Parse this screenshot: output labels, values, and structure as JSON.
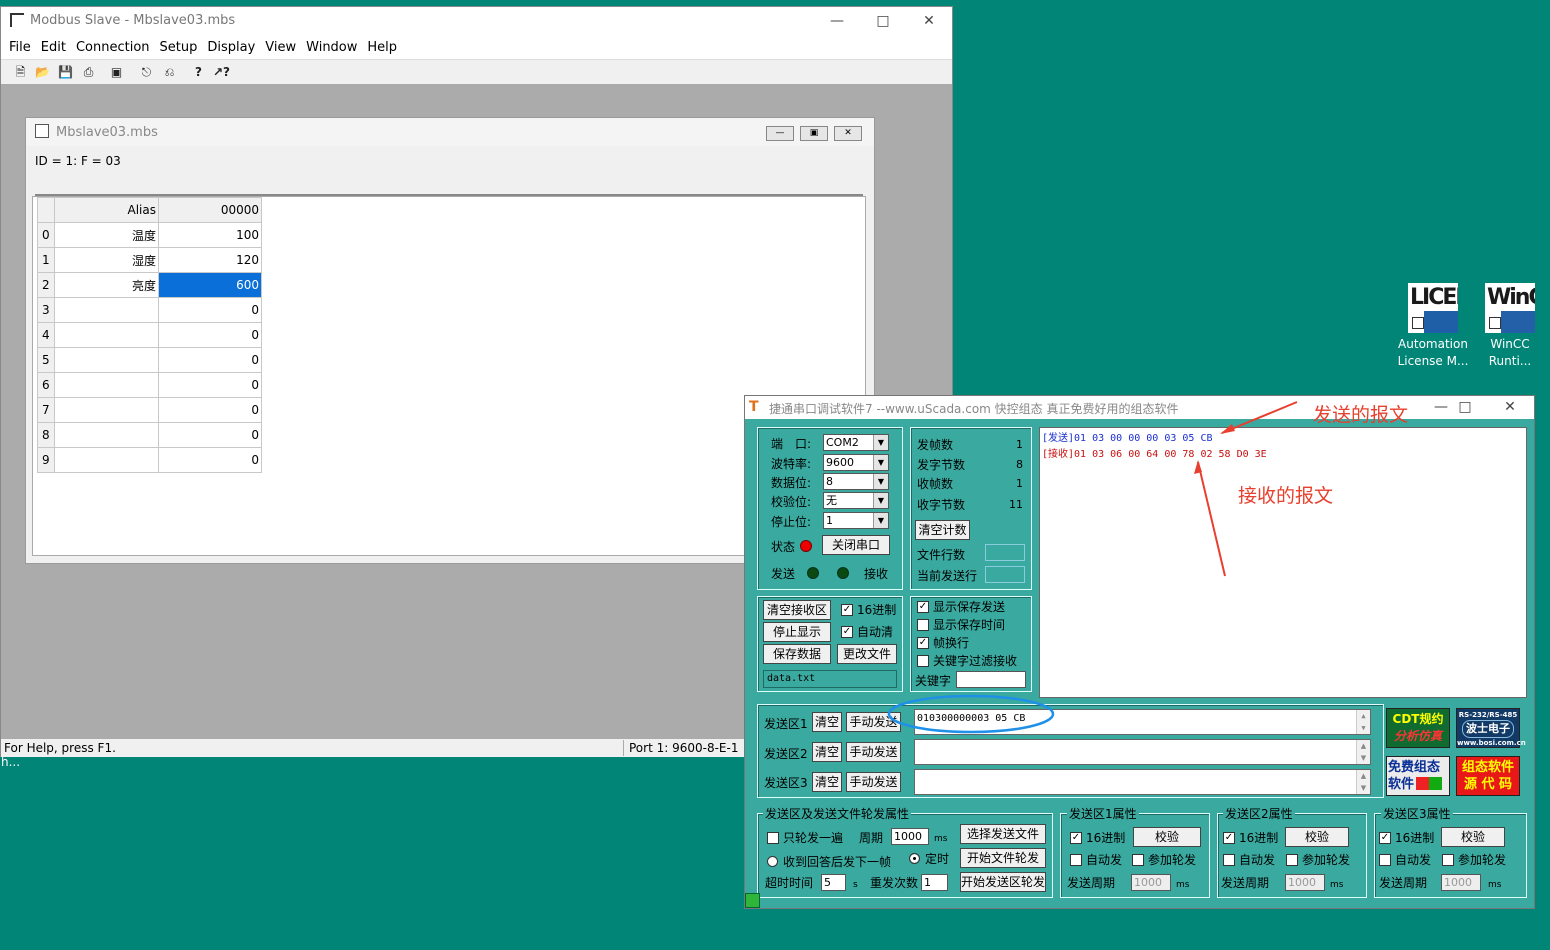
{
  "desktop": {
    "icons": [
      {
        "thumb": "LICEN",
        "line1": "Automation",
        "line2": "License M..."
      },
      {
        "thumb": "WinC",
        "line1": "WinCC",
        "line2": "Runti..."
      }
    ],
    "stray_text": "h..."
  },
  "modbus": {
    "title": "Modbus Slave - Mbslave03.mbs",
    "menu": [
      "File",
      "Edit",
      "Connection",
      "Setup",
      "Display",
      "View",
      "Window",
      "Help"
    ],
    "status_left": "For Help, press F1.",
    "status_right": "Port 1: 9600-8-E-1",
    "child": {
      "title": "Mbslave03.mbs",
      "header": "ID = 1: F = 03",
      "col_alias": "Alias",
      "col_addr": "00000",
      "rows": [
        {
          "n": "0",
          "alias": "温度",
          "value": "100"
        },
        {
          "n": "1",
          "alias": "湿度",
          "value": "120"
        },
        {
          "n": "2",
          "alias": "亮度",
          "value": "600"
        },
        {
          "n": "3",
          "alias": "",
          "value": "0"
        },
        {
          "n": "4",
          "alias": "",
          "value": "0"
        },
        {
          "n": "5",
          "alias": "",
          "value": "0"
        },
        {
          "n": "6",
          "alias": "",
          "value": "0"
        },
        {
          "n": "7",
          "alias": "",
          "value": "0"
        },
        {
          "n": "8",
          "alias": "",
          "value": "0"
        },
        {
          "n": "9",
          "alias": "",
          "value": "0"
        }
      ]
    }
  },
  "serial": {
    "title": "捷通串口调试软件7  --www.uScada.com  快控组态  真正免费好用的组态软件",
    "port_label": "端　口:",
    "port_value": "COM2",
    "baud_label": "波特率:",
    "baud_value": "9600",
    "data_label": "数据位:",
    "data_value": "8",
    "parity_label": "校验位:",
    "parity_value": "无",
    "stop_label": "停止位:",
    "stop_value": "1",
    "state_label": "状态",
    "close_port": "关闭串口",
    "send_label": "发送",
    "recv_label": "接收",
    "stats": [
      {
        "label": "发帧数",
        "value": "1"
      },
      {
        "label": "发字节数",
        "value": "8"
      },
      {
        "label": "收帧数",
        "value": "1"
      },
      {
        "label": "收字节数",
        "value": "11"
      }
    ],
    "clear_count": "清空计数",
    "file_lines": "文件行数",
    "current_line": "当前发送行",
    "log_send": "[发送]01 03 00 00 00 03 05 CB",
    "log_recv": "[接收]01 03 06 00 64 00 78 02 58 D0 3E",
    "clear_recv": "清空接收区",
    "stop_display": "停止显示",
    "save_data": "保存数据",
    "change_file": "更改文件",
    "hex16": "16进制",
    "auto_clear": "自动清",
    "filename": "data.txt",
    "opt_show_save_send": "显示保存发送",
    "opt_show_save_time": "显示保存时间",
    "opt_frame_newline": "帧换行",
    "opt_keyword_filter": "关键字过滤接收",
    "keyword_label": "关键字",
    "send_areas": [
      {
        "label": "发送区1",
        "clear": "清空",
        "manual": "手动发送",
        "content": "010300000003 05 CB"
      },
      {
        "label": "发送区2",
        "clear": "清空",
        "manual": "手动发送",
        "content": ""
      },
      {
        "label": "发送区3",
        "clear": "清空",
        "manual": "手动发送",
        "content": ""
      }
    ],
    "logos": {
      "cdt1": "CDT规约",
      "cdt2": "分析仿真",
      "bosi1": "RS-232/RS-485",
      "bosi2": "波士电子",
      "bosi3": "www.bosi.com.cn",
      "free1": "免费组态",
      "free2": "软件",
      "src1": "组态软件",
      "src2": "源 代 码"
    },
    "poll": {
      "title": "发送区及发送文件轮发属性",
      "once": "只轮发一遍",
      "period": "周期",
      "period_value": "1000",
      "ms": "ms",
      "select_file": "选择发送文件",
      "after_reply": "收到回答后发下一帧",
      "timed": "定时",
      "start_file_poll": "开始文件轮发",
      "timeout": "超时时间",
      "timeout_value": "5",
      "s": "s",
      "retry": "重发次数",
      "retry_value": "1",
      "start_area_poll": "开始发送区轮发"
    },
    "area_props": [
      {
        "title": "发送区1属性",
        "hex": "16进制",
        "check": "校验",
        "auto": "自动发",
        "join": "参加轮发",
        "period": "发送周期",
        "period_value": "1000",
        "ms": "ms"
      },
      {
        "title": "发送区2属性",
        "hex": "16进制",
        "check": "校验",
        "auto": "自动发",
        "join": "参加轮发",
        "period": "发送周期",
        "period_value": "1000",
        "ms": "ms"
      },
      {
        "title": "发送区3属性",
        "hex": "16进制",
        "check": "校验",
        "auto": "自动发",
        "join": "参加轮发",
        "period": "发送周期",
        "period_value": "1000",
        "ms": "ms"
      }
    ]
  },
  "annotations": {
    "send_msg": "发送的报文",
    "recv_msg": "接收的报文",
    "red": "#e8402e",
    "blue": "#1e90e8"
  }
}
